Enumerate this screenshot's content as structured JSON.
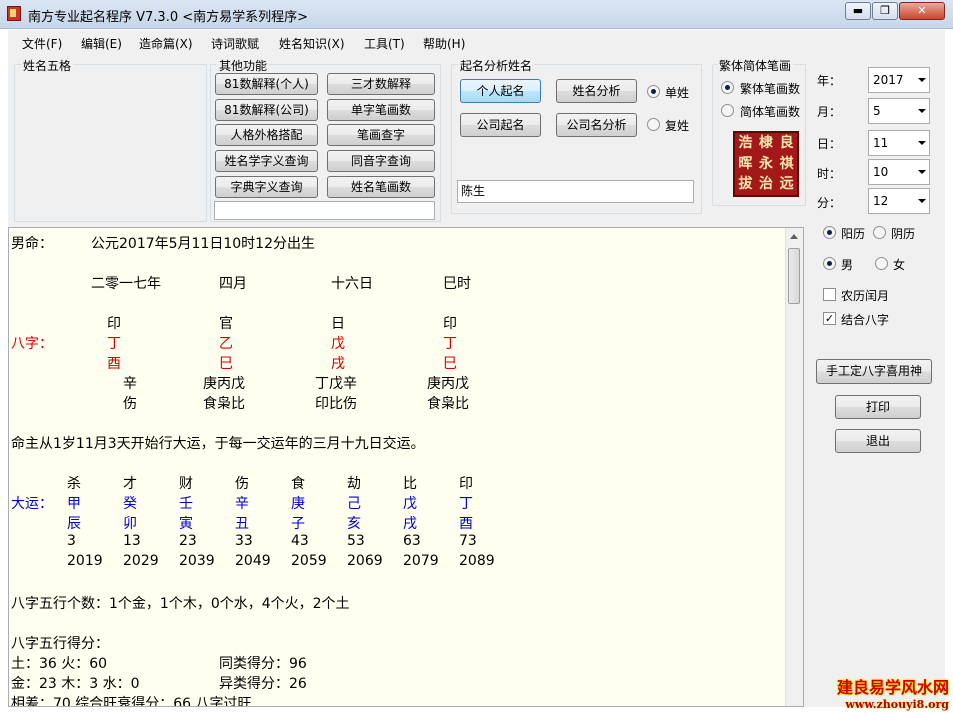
{
  "window": {
    "title": "南方专业起名程序 V7.3.0   <南方易学系列程序>",
    "minimize": "▬",
    "maximize": "❐",
    "close": "✕"
  },
  "menu": [
    "文件(F)",
    "编辑(E)",
    "造命篇(X)",
    "诗词歌赋",
    "姓名知识(X)",
    "工具(T)",
    "帮助(H)"
  ],
  "groups": {
    "name_wuge": "姓名五格",
    "other": "其他功能",
    "analysis": "起名分析姓名",
    "strokes": "繁体简体笔画"
  },
  "other_buttons": [
    "81数解释(个人)",
    "三才数解释",
    "81数解释(公司)",
    "单字笔画数",
    "人格外格搭配",
    "笔画查字",
    "姓名学字义查询",
    "同音字查询",
    "字典字义查询",
    "姓名笔画数"
  ],
  "analysis_buttons": [
    "个人起名",
    "姓名分析",
    "公司起名",
    "公司名分析"
  ],
  "surname_radio": {
    "single": "单姓",
    "double": "复姓"
  },
  "name_input": "陈生",
  "stroke_radio": {
    "traditional": "繁体笔画数",
    "simplified": "简体笔画数"
  },
  "seal_chars": [
    "浩",
    "棣",
    "良",
    "晖",
    "永",
    "祺",
    "拔",
    "治",
    "远"
  ],
  "date": {
    "year_label": "年：",
    "year": "2017",
    "month_label": "月：",
    "month": "5",
    "day_label": "日：",
    "day": "11",
    "hour_label": "时：",
    "hour": "10",
    "minute_label": "分：",
    "minute": "12"
  },
  "calendar_radio": {
    "solar": "阳历",
    "lunar": "阴历"
  },
  "gender_radio": {
    "male": "男",
    "female": "女"
  },
  "checks": {
    "leap_month": "农历闰月",
    "combine_bazi": "结合八字"
  },
  "side_buttons": {
    "manual": "手工定八字喜用神",
    "print": "打印",
    "exit": "退出"
  },
  "report": {
    "line1_label": "男命：",
    "line1_value": "公元2017年5月11日10时12分出生",
    "lunar": [
      "二零一七年",
      "四月",
      "十六日",
      "巳时"
    ],
    "gods_top": [
      "印",
      "官",
      "日",
      "印"
    ],
    "bazi_label": "八字：",
    "stems": [
      "丁",
      "乙",
      "戊",
      "丁"
    ],
    "branches": [
      "酉",
      "巳",
      "戌",
      "巳"
    ],
    "hidden_stems": [
      "辛",
      "庚丙戊",
      "丁戊辛",
      "庚丙戊"
    ],
    "hidden_gods": [
      "伤",
      "食枭比",
      "印比伤",
      "食枭比"
    ],
    "luck_intro": "命主从1岁11月3天开始行大运，于每一交运年的三月十九日交运。",
    "dayun_label": "大运：",
    "dayun_gods": [
      "杀",
      "才",
      "财",
      "伤",
      "食",
      "劫",
      "比",
      "印"
    ],
    "dayun_stems": [
      "甲",
      "癸",
      "壬",
      "辛",
      "庚",
      "己",
      "戊",
      "丁"
    ],
    "dayun_branches": [
      "辰",
      "卯",
      "寅",
      "丑",
      "子",
      "亥",
      "戌",
      "酉"
    ],
    "dayun_ages": [
      "3",
      "13",
      "23",
      "33",
      "43",
      "53",
      "63",
      "73"
    ],
    "dayun_years": [
      "2019",
      "2029",
      "2039",
      "2049",
      "2059",
      "2069",
      "2079",
      "2089"
    ],
    "wuxing_count": "八字五行个数：1个金，1个木，0个水，4个火，2个土",
    "wuxing_score_title": "八字五行得分：",
    "score_line1_a": "土：36  火：60",
    "score_line1_b": "同类得分：96",
    "score_line2_a": "金：23  木：3  水：0",
    "score_line2_b": "异类得分：26",
    "score_line3": "相差：70  综合旺衰得分：66  八字过旺"
  },
  "watermark": {
    "line1": "建良易学风水网",
    "line2": "www.zhouyi8.org"
  }
}
